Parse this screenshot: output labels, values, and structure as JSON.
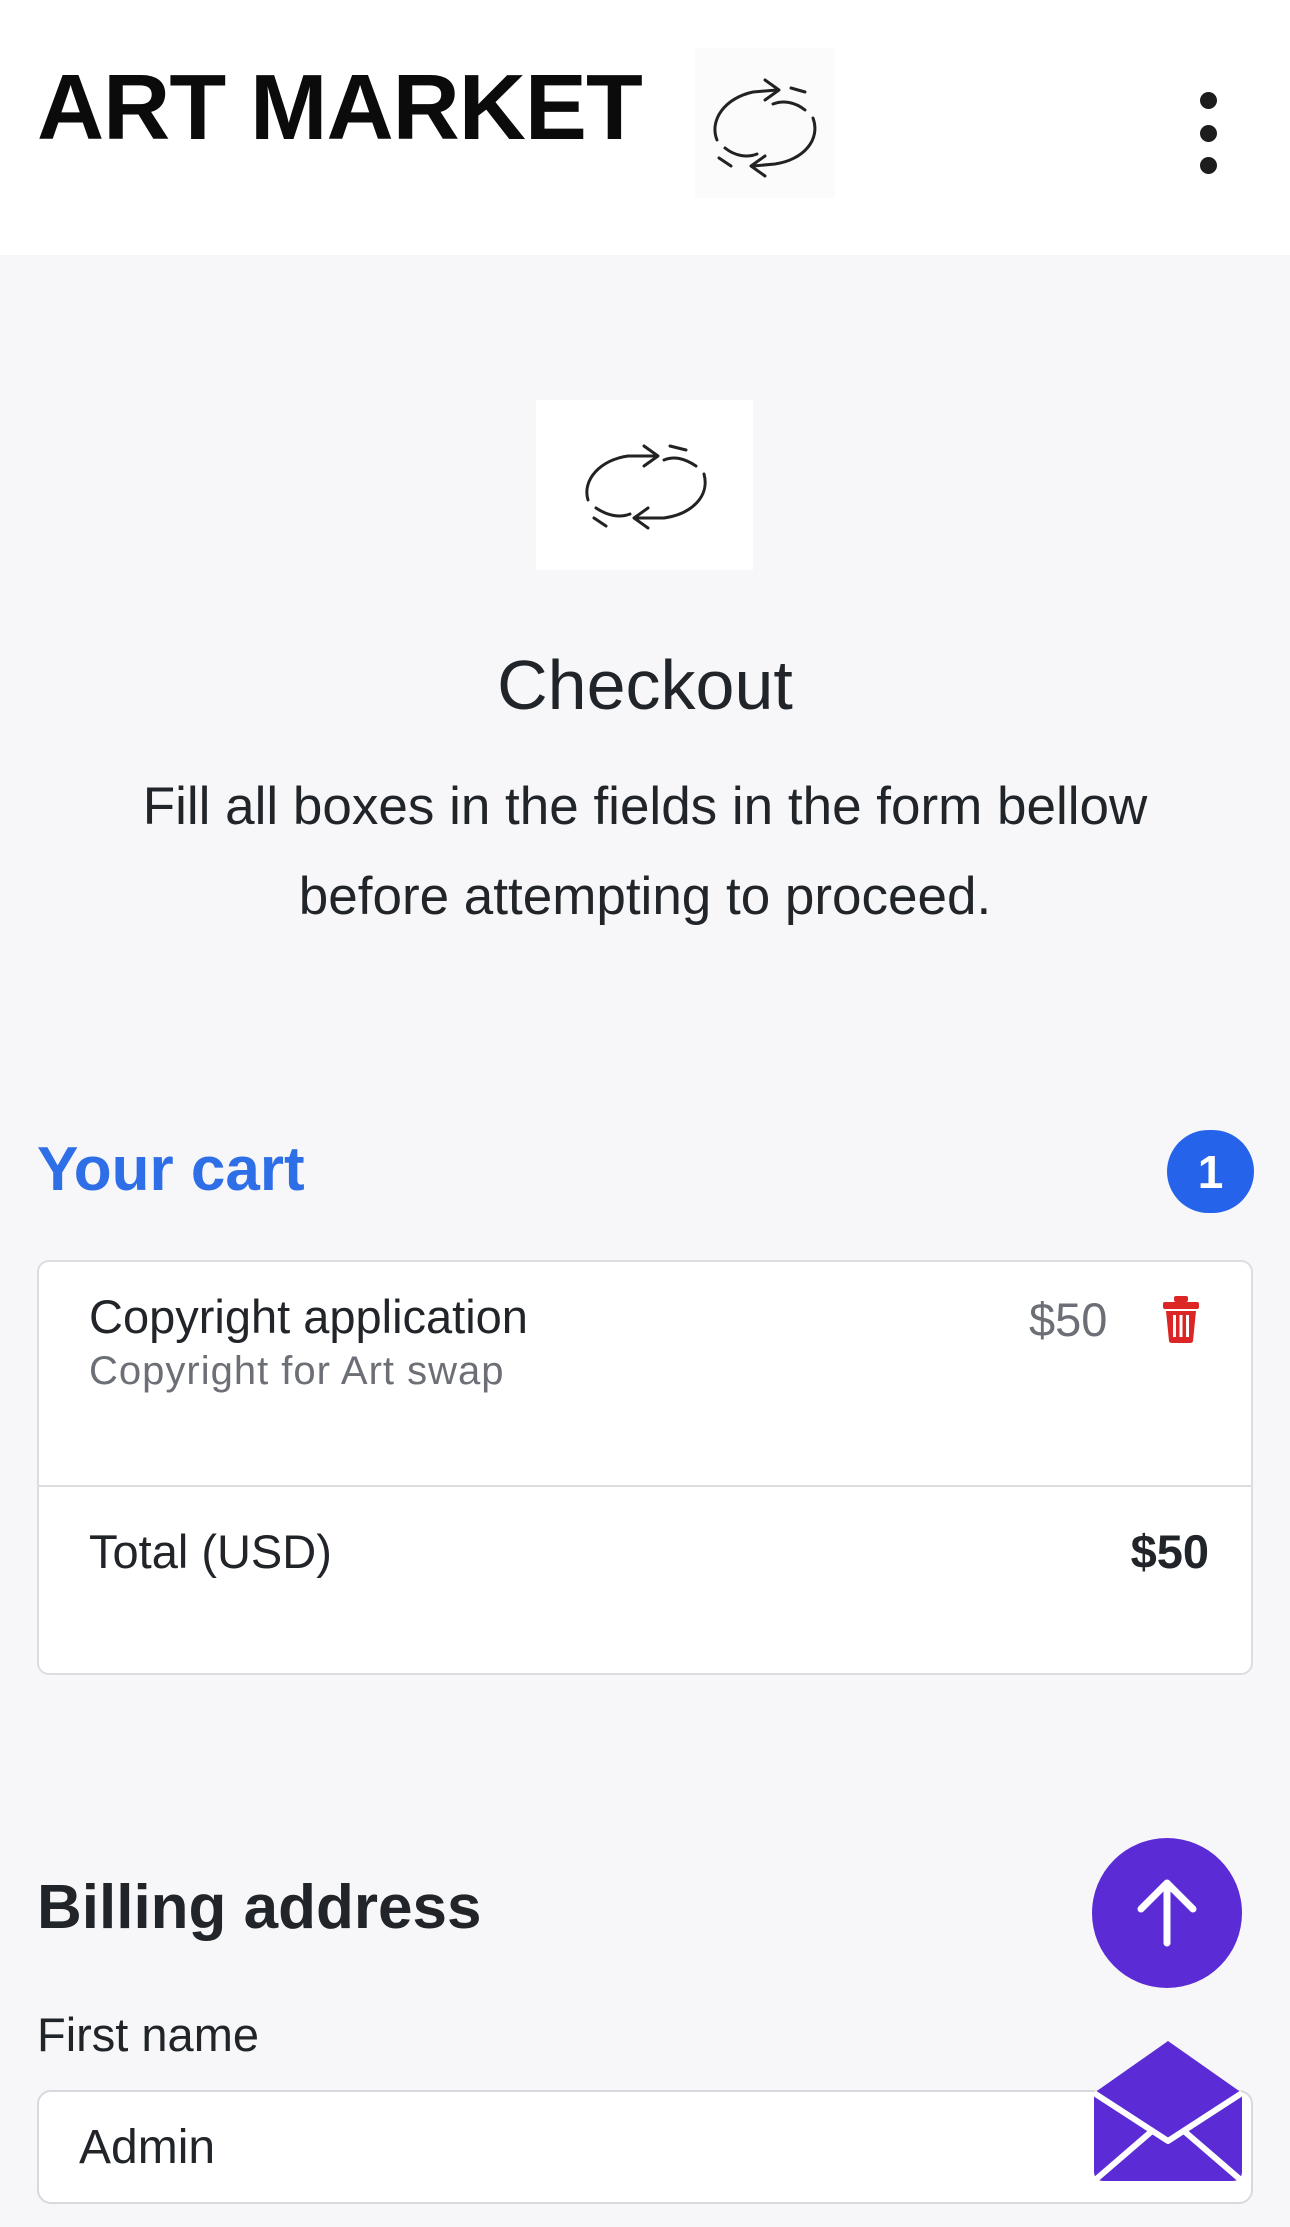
{
  "header": {
    "brand": "ART MARKET",
    "logo_icon": "circular-arrows-swap-icon",
    "menu_icon": "more-vertical-icon"
  },
  "hero": {
    "logo_icon": "circular-arrows-swap-icon",
    "title": "Checkout",
    "subtitle": "Fill all boxes in the fields in the form bellow before attempting to proceed."
  },
  "cart": {
    "title": "Your cart",
    "count": "1",
    "items": [
      {
        "name": "Copyright application",
        "description": "Copyright for Art swap",
        "price": "$50",
        "remove_icon": "trash-icon"
      }
    ],
    "total_label": "Total (USD)",
    "total_value": "$50"
  },
  "billing": {
    "title": "Billing address",
    "first_name_label": "First name",
    "first_name_value": "Admin"
  },
  "floating": {
    "scroll_top_icon": "arrow-up-icon",
    "mail_icon": "envelope-icon"
  },
  "colors": {
    "accent": "#2e6ee6",
    "badge": "#2563eb",
    "fab": "#5b2bd6",
    "danger": "#dc2626",
    "page_bg": "#f7f7f9"
  }
}
